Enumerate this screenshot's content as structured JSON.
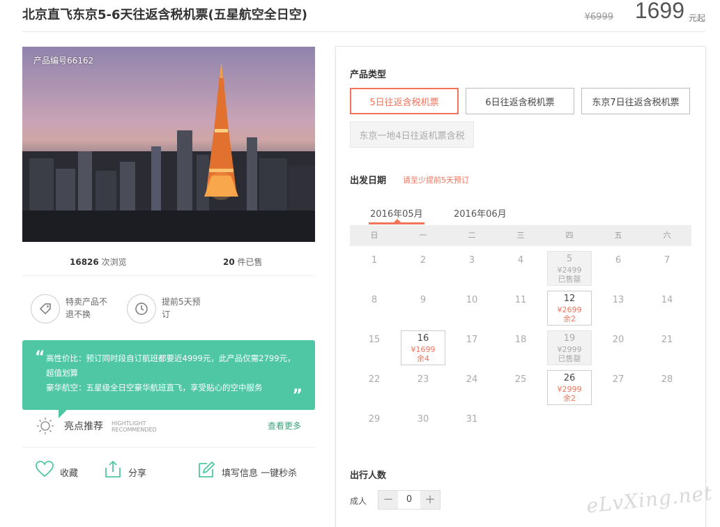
{
  "header": {
    "title": "北京直飞东京5-6天往返含税机票(五星航空全日空)",
    "old_price": "¥6999",
    "price": "1699",
    "price_unit": "元起"
  },
  "hero": {
    "product_id": "产品编号66162"
  },
  "stats": {
    "views": "16826",
    "views_label": "次浏览",
    "sold": "20",
    "sold_label": "件已售"
  },
  "features": [
    {
      "text": "特卖产品不退不换",
      "icon": "tag-icon"
    },
    {
      "text": "提前5天预订",
      "icon": "clock-icon"
    }
  ],
  "highlight_bubble": {
    "line1": "高性价比：预订同时段自订航班都要近4999元，此产品仅需2799元，超值划算",
    "line2": "豪华航空：五星级全日空豪华航班直飞，享受贴心的空中服务"
  },
  "highlights": {
    "title": "亮点推荐",
    "en1": "HIGHTLIGHT",
    "en2": "RECOMMENDED",
    "more": "查看更多"
  },
  "actions": {
    "favorite": "收藏",
    "share": "分享",
    "fill_info": "填写信息 一键秒杀"
  },
  "product_types": {
    "label": "产品类型",
    "options": [
      "5日往返含税机票",
      "6日往返含税机票",
      "东京7日往返含税机票",
      "东京一地4日往返机票含税"
    ]
  },
  "departure": {
    "label": "出发日期",
    "note": "请至少提前5天预订",
    "months": [
      "2016年05月",
      "2016年06月"
    ],
    "weekdays": [
      "日",
      "一",
      "二",
      "三",
      "四",
      "五",
      "六"
    ]
  },
  "calendar": {
    "weeks": [
      [
        {
          "d": "1"
        },
        {
          "d": "2"
        },
        {
          "d": "3"
        },
        {
          "d": "4"
        },
        {
          "d": "5",
          "p": "¥2499",
          "r": "已售罄",
          "s": "sold"
        },
        {
          "d": "6"
        },
        {
          "d": "7"
        }
      ],
      [
        {
          "d": "8"
        },
        {
          "d": "9"
        },
        {
          "d": "10"
        },
        {
          "d": "11"
        },
        {
          "d": "12",
          "p": "¥2699",
          "r": "余2",
          "s": "avail"
        },
        {
          "d": "13"
        },
        {
          "d": "14"
        }
      ],
      [
        {
          "d": "15"
        },
        {
          "d": "16",
          "p": "¥1699",
          "r": "余4",
          "s": "avail"
        },
        {
          "d": "17"
        },
        {
          "d": "18"
        },
        {
          "d": "19",
          "p": "¥2999",
          "r": "已售罄",
          "s": "sold"
        },
        {
          "d": "20"
        },
        {
          "d": "21"
        }
      ],
      [
        {
          "d": "22"
        },
        {
          "d": "23"
        },
        {
          "d": "24"
        },
        {
          "d": "25"
        },
        {
          "d": "26",
          "p": "¥2999",
          "r": "余2",
          "s": "avail"
        },
        {
          "d": "27"
        },
        {
          "d": "28"
        }
      ],
      [
        {
          "d": "29"
        },
        {
          "d": "30"
        },
        {
          "d": "31"
        }
      ]
    ]
  },
  "travelers": {
    "label": "出行人数",
    "adult_label": "成人",
    "count": "0",
    "minus": "−",
    "plus": "+"
  },
  "watermark": "eLvXing.net"
}
